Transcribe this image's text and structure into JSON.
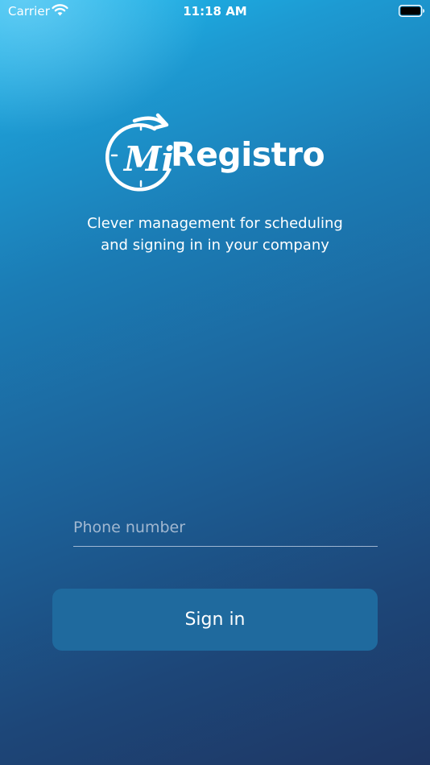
{
  "status_bar": {
    "carrier": "Carrier",
    "time": "11:18 AM",
    "wifi_icon": "wifi-icon",
    "battery_icon": "battery-icon"
  },
  "logo": {
    "script_text": "Mi",
    "word_text": "Registro",
    "icon": "clock-arrow-icon"
  },
  "tagline": {
    "line1": "Clever management for scheduling",
    "line2": "and signing in in your company"
  },
  "form": {
    "phone_placeholder": "Phone number",
    "phone_value": "",
    "signin_label": "Sign in"
  },
  "colors": {
    "background_top": "#1cbbef",
    "background_bottom": "#1e3663",
    "button": "#1f6a9e",
    "text": "#ffffff"
  }
}
